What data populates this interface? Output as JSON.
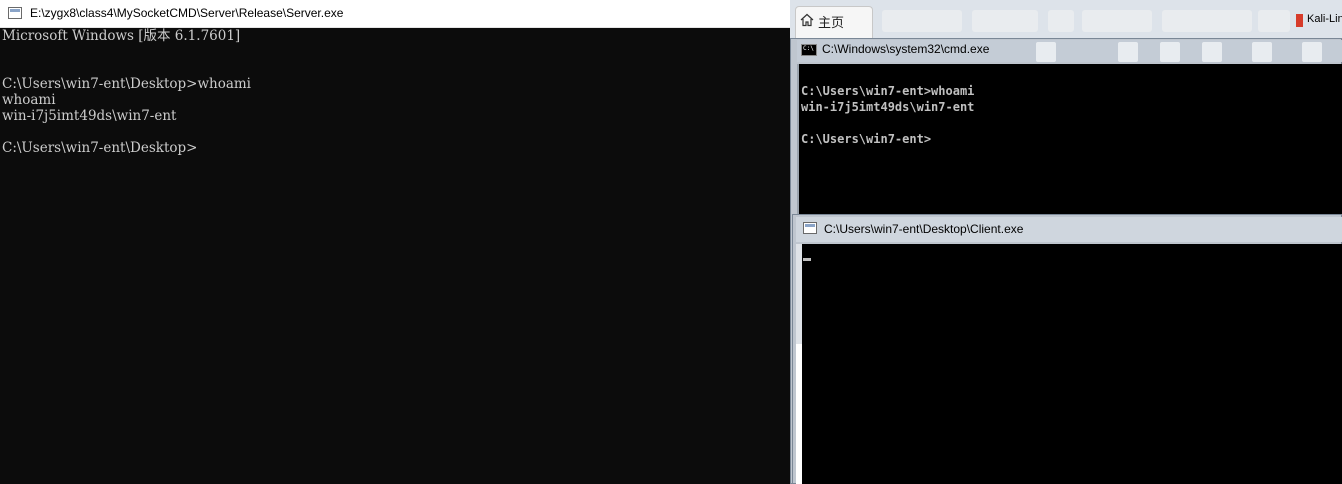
{
  "server_window": {
    "title": "E:\\zygx8\\class4\\MySocketCMD\\Server\\Release\\Server.exe",
    "console_lines": [
      "Microsoft Windows [版本 6.1.7601]",
      "",
      "",
      "C:\\Users\\win7-ent\\Desktop>whoami",
      "whoami",
      "win-i7j5imt49ds\\win7-ent",
      "",
      "C:\\Users\\win7-ent\\Desktop>"
    ]
  },
  "browser": {
    "home_tab_label": "主页",
    "kali_tab_label": "Kali-Lin"
  },
  "cmd_window": {
    "title": "C:\\Windows\\system32\\cmd.exe",
    "console_lines": [
      "C:\\Users\\win7-ent>whoami",
      "win-i7j5imt49ds\\win7-ent",
      "",
      "C:\\Users\\win7-ent>"
    ]
  },
  "client_window": {
    "title": "C:\\Users\\win7-ent\\Desktop\\Client.exe"
  },
  "colors": {
    "console_bg": "#0c0c0c",
    "console_text": "#cccccc",
    "titlebar_bg": "#ffffff"
  }
}
